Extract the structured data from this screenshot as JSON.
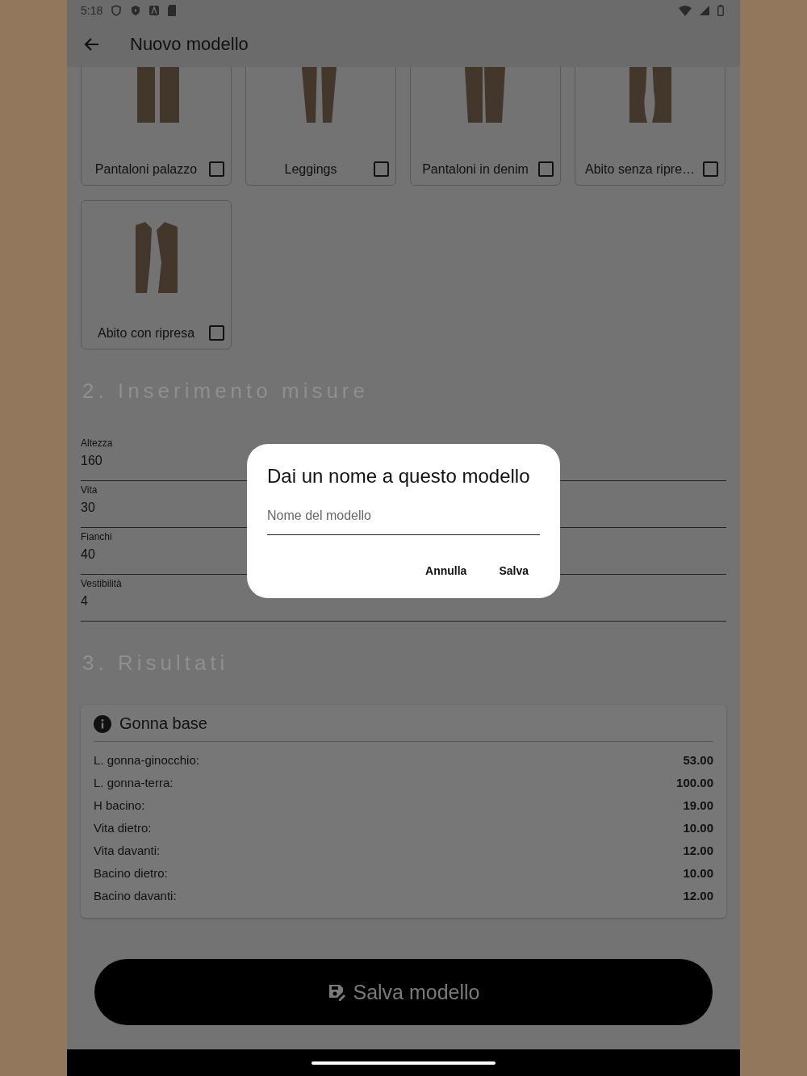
{
  "status_bar": {
    "time": "5:18"
  },
  "app_bar": {
    "title": "Nuovo modello"
  },
  "models": [
    {
      "label": "Pantaloni palazzo",
      "kind": "wide",
      "checked": false
    },
    {
      "label": "Leggings",
      "kind": "slim",
      "checked": false
    },
    {
      "label": "Pantaloni in denim",
      "kind": "denim",
      "checked": false
    },
    {
      "label": "Abito senza ripre…",
      "kind": "dress",
      "checked": false
    },
    {
      "label": "Abito con ripresa",
      "kind": "darted",
      "checked": false
    }
  ],
  "measurements": {
    "title": "2. Inserimento misure",
    "fields": [
      {
        "label": "Altezza",
        "value": "160"
      },
      {
        "label": "Vita",
        "value": "30"
      },
      {
        "label": "Fianchi",
        "value": "40"
      },
      {
        "label": "Vestibilità",
        "value": "4"
      }
    ]
  },
  "results": {
    "title": "3. Risultati",
    "card": {
      "title": "Gonna base",
      "rows": [
        {
          "label": "L. gonna-ginocchio:",
          "value": "53.00"
        },
        {
          "label": "L. gonna-terra:",
          "value": "100.00"
        },
        {
          "label": "H bacino:",
          "value": "19.00"
        },
        {
          "label": "Vita dietro:",
          "value": "10.00"
        },
        {
          "label": "Vita davanti:",
          "value": "12.00"
        },
        {
          "label": "Bacino dietro:",
          "value": "10.00"
        },
        {
          "label": "Bacino davanti:",
          "value": "12.00"
        }
      ]
    }
  },
  "save_button": "Salva modello",
  "dialog": {
    "title": "Dai un nome a questo modello",
    "placeholder": "Nome del modello",
    "buttons": [
      "Annulla",
      "Salva"
    ]
  }
}
